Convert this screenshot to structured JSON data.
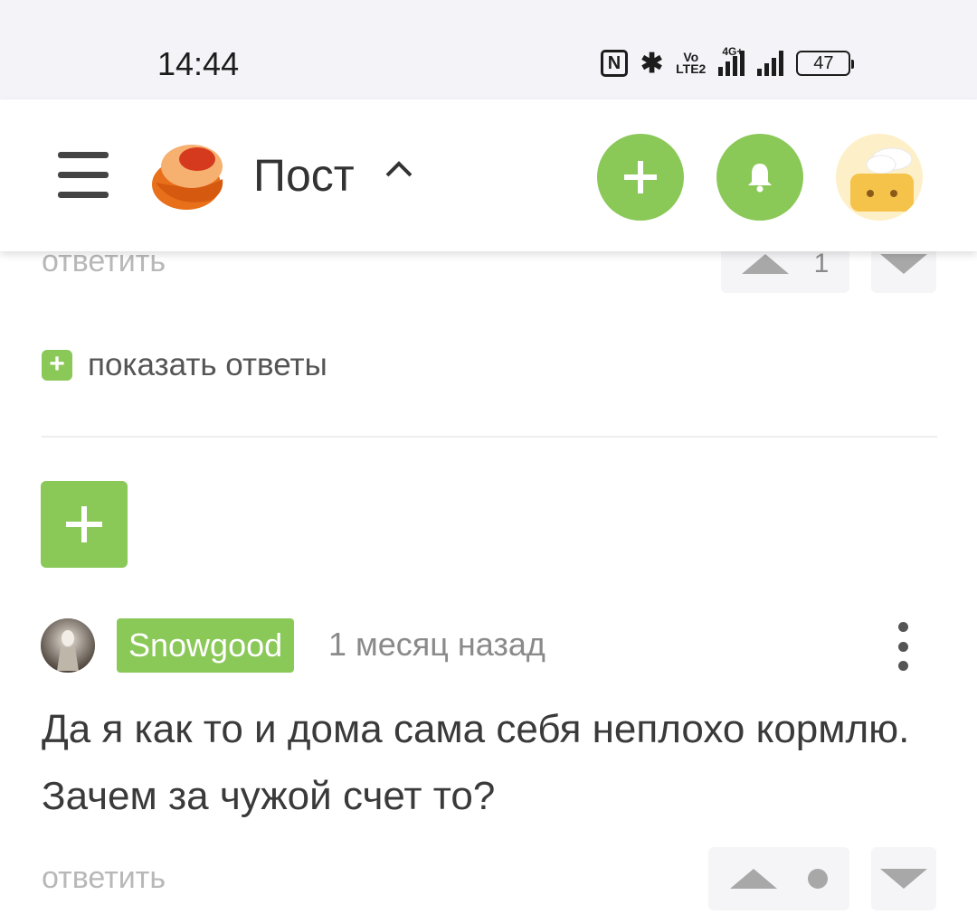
{
  "status_bar": {
    "time": "14:44",
    "nfc_glyph": "N",
    "bluetooth_glyph": "✱",
    "volte_line1": "Vo",
    "volte_line2": "LTE2",
    "network_type": "4G+",
    "battery": "47"
  },
  "header": {
    "title": "Пост",
    "menu_icon": "hamburger-icon",
    "logo_icon": "cupcake-logo",
    "add_icon": "plus-icon",
    "notifications_icon": "bell-icon",
    "profile_icon": "avatar-image"
  },
  "previous_comment": {
    "reply_label": "ответить",
    "score": "1",
    "show_replies_label": "показать ответы",
    "show_replies_icon": "plus-icon"
  },
  "add_comment_icon": "plus-icon",
  "comment": {
    "author": "Snowgood",
    "time_ago": "1 месяц назад",
    "text": "Да я как то и дома сама себя неплохо кормлю. Зачем за чужой счет то?",
    "reply_label": "ответить",
    "score_indicator": "dot",
    "more_icon": "kebab-icon"
  },
  "colors": {
    "accent_green": "#8ac858",
    "status_bar_bg": "#f3f3f8",
    "muted_text": "#b8b8b8"
  }
}
